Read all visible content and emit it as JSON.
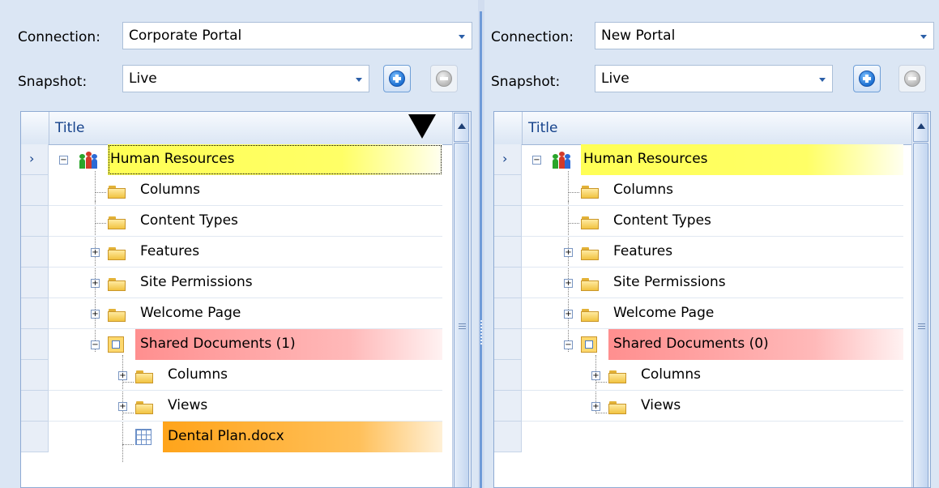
{
  "left": {
    "connection_label": "Connection:",
    "connection_value": "Corporate Portal",
    "snapshot_label": "Snapshot:",
    "snapshot_value": "Live",
    "column_title": "Title",
    "rows": [
      {
        "label": "Human Resources"
      },
      {
        "label": "Columns"
      },
      {
        "label": "Content Types"
      },
      {
        "label": "Features"
      },
      {
        "label": "Site Permissions"
      },
      {
        "label": "Welcome Page"
      },
      {
        "label": "Shared Documents (1)"
      },
      {
        "label": "Columns"
      },
      {
        "label": "Views"
      },
      {
        "label": "Dental Plan.docx"
      }
    ]
  },
  "right": {
    "connection_label": "Connection:",
    "connection_value": "New Portal",
    "snapshot_label": "Snapshot:",
    "snapshot_value": "Live",
    "column_title": "Title",
    "rows": [
      {
        "label": "Human Resources"
      },
      {
        "label": "Columns"
      },
      {
        "label": "Content Types"
      },
      {
        "label": "Features"
      },
      {
        "label": "Site Permissions"
      },
      {
        "label": "Welcome Page"
      },
      {
        "label": "Shared Documents (0)"
      },
      {
        "label": "Columns"
      },
      {
        "label": "Views"
      }
    ]
  },
  "colors": {
    "highlight_site": "#ffff55",
    "highlight_changed": "#ff8f8f",
    "highlight_added": "#ffa41a",
    "accent": "#15428b"
  },
  "icons": [
    "add-snapshot-icon",
    "remove-snapshot-icon",
    "site-icon",
    "folder-icon",
    "document-library-icon",
    "document-icon",
    "sort-indicator-icon"
  ]
}
